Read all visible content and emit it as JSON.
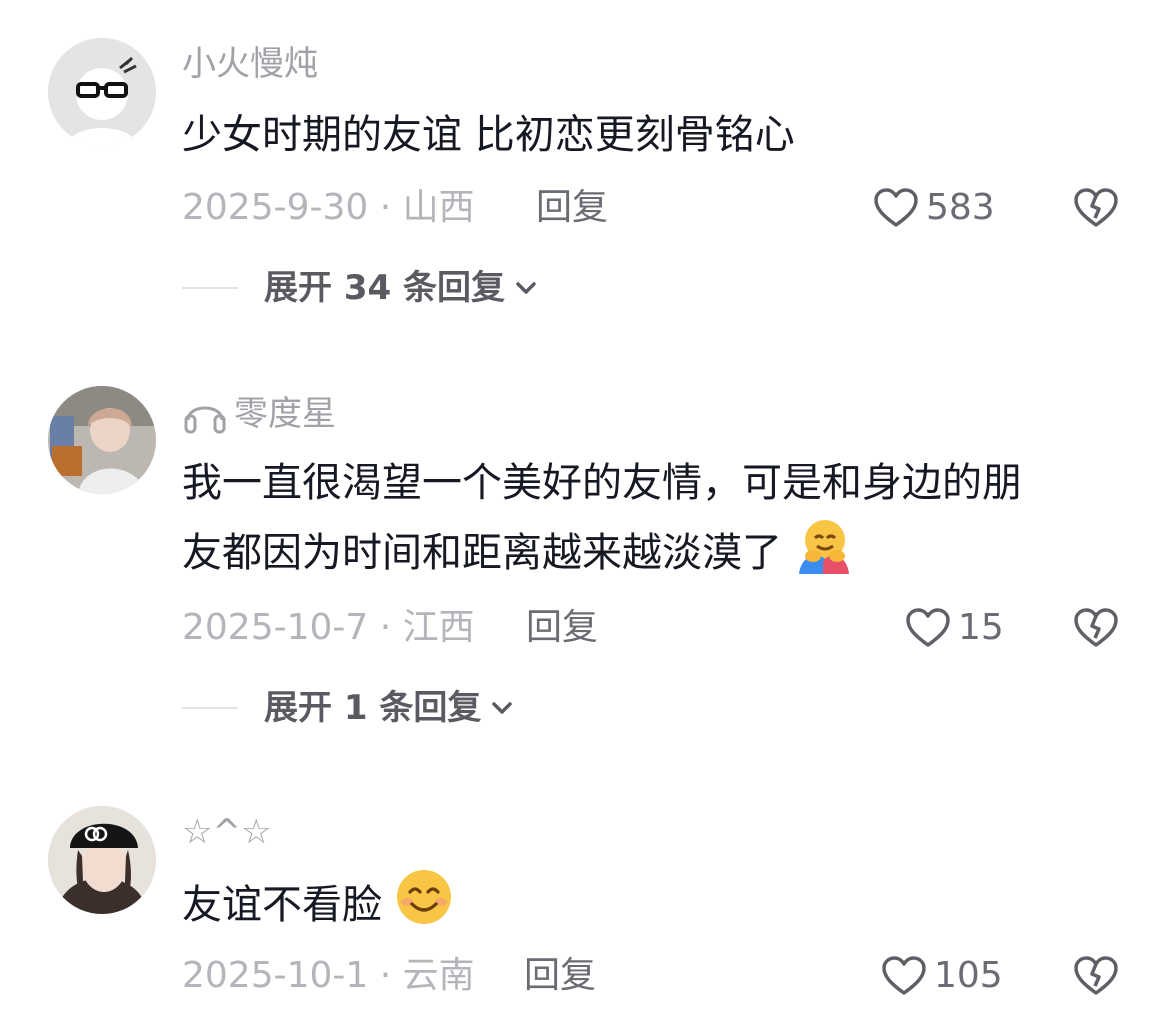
{
  "comments": [
    {
      "username": "小火慢炖",
      "text": "少女时期的友谊 比初恋更刻骨铭心",
      "date_location": "2025-9-30 · 山西",
      "reply_label": "回复",
      "likes": "583",
      "expand_label": "展开 34 条回复"
    },
    {
      "username": "零度星",
      "username_icon": "headphones-icon",
      "text_line1": "我一直很渴望一个美好的友情，可是和身边的朋",
      "text_line2": "友都因为时间和距离越来越淡漠了",
      "text_emoji": "hugging-face-emoji",
      "date_location": "2025-10-7 · 江西",
      "reply_label": "回复",
      "likes": "15",
      "expand_label": "展开 1 条回复"
    },
    {
      "username": "☆^☆",
      "text": "友谊不看脸",
      "text_emoji": "smiling-face-emoji",
      "date_location": "2025-10-1 · 云南",
      "reply_label": "回复",
      "likes": "105"
    }
  ]
}
